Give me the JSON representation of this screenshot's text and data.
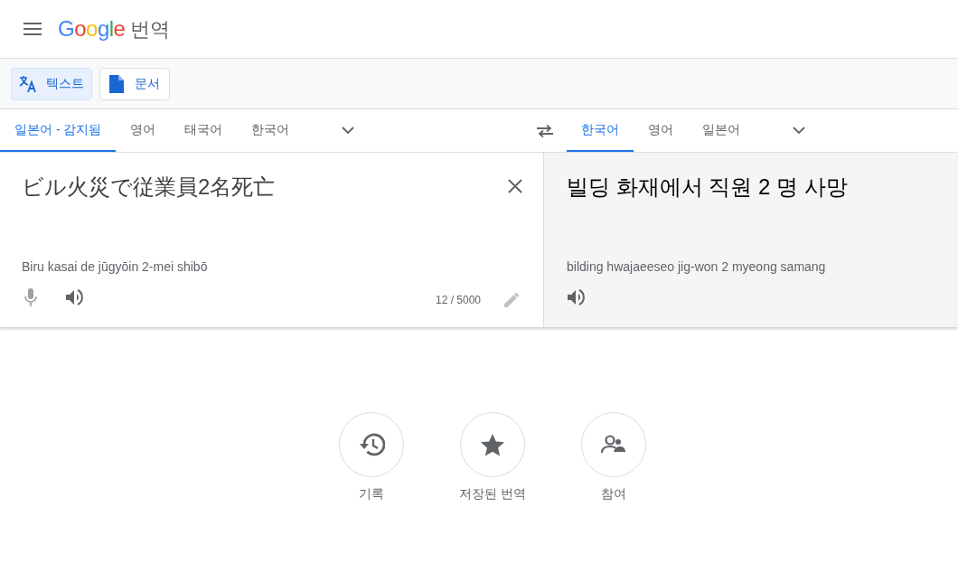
{
  "header": {
    "logo": "Google",
    "product": "번역"
  },
  "modes": [
    {
      "label": "텍스트",
      "kind": "text",
      "selected": true
    },
    {
      "label": "문서",
      "kind": "document",
      "selected": false
    }
  ],
  "source_languages": [
    {
      "label": "일본어 - 감지됨",
      "selected": true
    },
    {
      "label": "영어",
      "selected": false
    },
    {
      "label": "태국어",
      "selected": false
    },
    {
      "label": "한국어",
      "selected": false
    }
  ],
  "target_languages": [
    {
      "label": "한국어",
      "selected": true
    },
    {
      "label": "영어",
      "selected": false
    },
    {
      "label": "일본어",
      "selected": false
    }
  ],
  "source": {
    "text": "ビル火災で従業員2名死亡",
    "romanization": "Biru kasai de jūgyōin 2-mei shibō",
    "char_count": "12 / 5000"
  },
  "target": {
    "text": "빌딩 화재에서 직원 2 명 사망",
    "romanization": "bilding hwajaeeseo jig-won 2 myeong samang"
  },
  "actions": [
    {
      "label": "기록",
      "kind": "history"
    },
    {
      "label": "저장된 번역",
      "kind": "saved"
    },
    {
      "label": "참여",
      "kind": "community"
    }
  ]
}
